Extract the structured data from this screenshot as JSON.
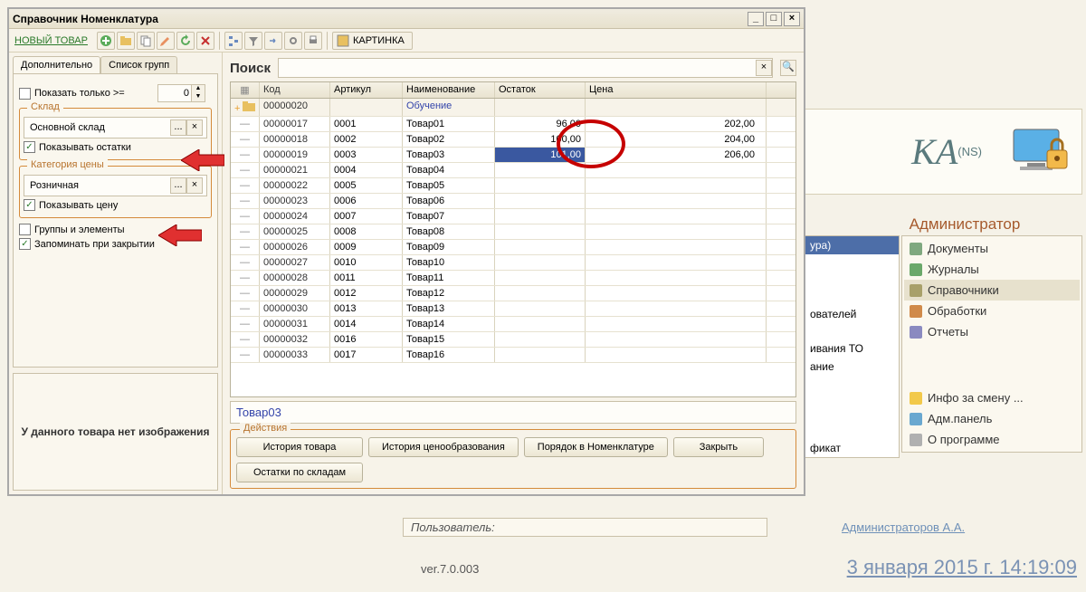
{
  "window": {
    "title": "Справочник Номенклатура",
    "toolbar": {
      "new_item": "НОВЫЙ ТОВАР",
      "picture": "КАРТИНКА"
    }
  },
  "sidepane": {
    "tabs": {
      "additional": "Дополнительно",
      "groups": "Список групп"
    },
    "show_only": "Показать только >=",
    "show_only_value": "0",
    "warehouse": {
      "legend": "Склад",
      "value": "Основной склад",
      "show_balance": "Показывать остатки"
    },
    "price_cat": {
      "legend": "Категория цены",
      "value": "Розничная",
      "show_price": "Показывать цену"
    },
    "groups_elements": "Группы и элементы",
    "remember": "Запоминать при закрытии",
    "no_image": "У данного товара нет изображения"
  },
  "search": {
    "label": "Поиск"
  },
  "grid": {
    "headers": {
      "code": "Код",
      "article": "Артикул",
      "name": "Наименование",
      "balance": "Остаток",
      "price": "Цена"
    },
    "rows": [
      {
        "folder": true,
        "code": "00000020",
        "art": "",
        "name": "Обучение",
        "bal": "",
        "price": ""
      },
      {
        "folder": false,
        "code": "00000017",
        "art": "0001",
        "name": "Товар01",
        "bal": "96,00",
        "price": "202,00"
      },
      {
        "folder": false,
        "code": "00000018",
        "art": "0002",
        "name": "Товар02",
        "bal": "100,00",
        "price": "204,00"
      },
      {
        "folder": false,
        "selected": true,
        "code": "00000019",
        "art": "0003",
        "name": "Товар03",
        "bal": "101,00",
        "price": "206,00"
      },
      {
        "folder": false,
        "code": "00000021",
        "art": "0004",
        "name": "Товар04",
        "bal": "",
        "price": ""
      },
      {
        "folder": false,
        "code": "00000022",
        "art": "0005",
        "name": "Товар05",
        "bal": "",
        "price": ""
      },
      {
        "folder": false,
        "code": "00000023",
        "art": "0006",
        "name": "Товар06",
        "bal": "",
        "price": ""
      },
      {
        "folder": false,
        "code": "00000024",
        "art": "0007",
        "name": "Товар07",
        "bal": "",
        "price": ""
      },
      {
        "folder": false,
        "code": "00000025",
        "art": "0008",
        "name": "Товар08",
        "bal": "",
        "price": ""
      },
      {
        "folder": false,
        "code": "00000026",
        "art": "0009",
        "name": "Товар09",
        "bal": "",
        "price": ""
      },
      {
        "folder": false,
        "code": "00000027",
        "art": "0010",
        "name": "Товар10",
        "bal": "",
        "price": ""
      },
      {
        "folder": false,
        "code": "00000028",
        "art": "0011",
        "name": "Товар11",
        "bal": "",
        "price": ""
      },
      {
        "folder": false,
        "code": "00000029",
        "art": "0012",
        "name": "Товар12",
        "bal": "",
        "price": ""
      },
      {
        "folder": false,
        "code": "00000030",
        "art": "0013",
        "name": "Товар13",
        "bal": "",
        "price": ""
      },
      {
        "folder": false,
        "code": "00000031",
        "art": "0014",
        "name": "Товар14",
        "bal": "",
        "price": ""
      },
      {
        "folder": false,
        "code": "00000032",
        "art": "0016",
        "name": "Товар15",
        "bal": "",
        "price": ""
      },
      {
        "folder": false,
        "code": "00000033",
        "art": "0017",
        "name": "Товар16",
        "bal": "",
        "price": ""
      }
    ],
    "selected_name": "Товар03"
  },
  "actions": {
    "legend": "Действия",
    "history": "История товара",
    "pricing": "История ценообразования",
    "order": "Порядок в Номенклатуре",
    "close": "Закрыть",
    "stock": "Остатки по складам"
  },
  "bg": {
    "logo": "KA",
    "ns": "(NS)",
    "admin": "Администратор",
    "nav": {
      "docs": "Документы",
      "journals": "Журналы",
      "refs": "Справочники",
      "processing": "Обработки",
      "reports": "Отчеты",
      "shift": "Инфо за смену ...",
      "panel": "Адм.панель",
      "about": "О программе"
    },
    "left_list": {
      "item1": "ура)",
      "item2": "ователей",
      "item3": "ивания ТО",
      "item4": "ание",
      "item5": "фикат"
    },
    "user_label": "Пользователь:",
    "user_name": "Администраторов А.А.",
    "version": "ver.7.0.003",
    "datetime": "3 января 2015 г. 14:19:09"
  }
}
